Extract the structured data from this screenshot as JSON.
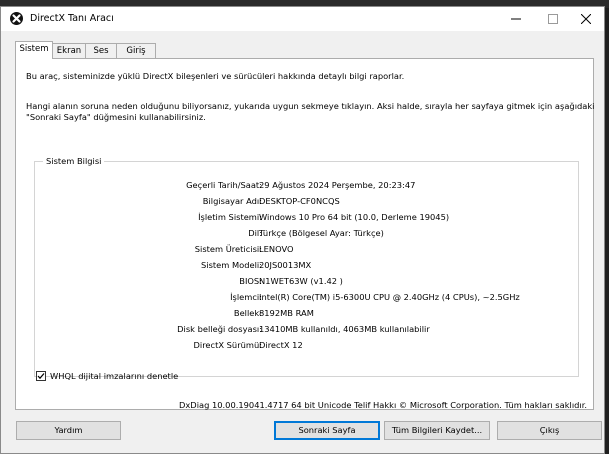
{
  "window": {
    "title": "DirectX Tanı Aracı"
  },
  "tabs": [
    {
      "label": "Sistem"
    },
    {
      "label": "Ekran"
    },
    {
      "label": "Ses"
    },
    {
      "label": "Giriş"
    }
  ],
  "intro": {
    "line1": "Bu araç, sisteminizde yüklü DirectX bileşenleri ve sürücüleri hakkında detaylı bilgi raporlar.",
    "line2": "Hangi alanın soruna neden olduğunu biliyorsanız, yukarıda uygun sekmeye tıklayın. Aksi halde, sırayla her sayfaya gitmek için aşağıdaki",
    "line3": "\"Sonraki Sayfa\" düğmesini kullanabilirsiniz."
  },
  "system_info": {
    "group_title": "Sistem Bilgisi",
    "rows": [
      {
        "label": "Geçerli Tarih/Saat:",
        "value": "29 Ağustos 2024 Perşembe, 20:23:47"
      },
      {
        "label": "Bilgisayar Adı:",
        "value": "DESKTOP-CF0NCQS"
      },
      {
        "label": "İşletim Sistemi:",
        "value": "Windows 10 Pro 64 bit (10.0, Derleme 19045)"
      },
      {
        "label": "Dil:",
        "value": "Türkçe (Bölgesel Ayar: Türkçe)"
      },
      {
        "label": "Sistem Üreticisi:",
        "value": "LENOVO"
      },
      {
        "label": "Sistem Modeli:",
        "value": "20JS0013MX"
      },
      {
        "label": "BIOS:",
        "value": "N1WET63W (v1.42 )"
      },
      {
        "label": "İşlemci:",
        "value": "Intel(R) Core(TM) i5-6300U CPU @ 2.40GHz (4 CPUs), ~2.5GHz"
      },
      {
        "label": "Bellek:",
        "value": "8192MB RAM"
      },
      {
        "label": "Disk belleği dosyası:",
        "value": "13410MB kullanıldı, 4063MB kullanılabilir"
      },
      {
        "label": "DirectX Sürümü:",
        "value": "DirectX 12"
      }
    ]
  },
  "whql": {
    "label": "WHQL dijital imzalarını denetle",
    "checked": true
  },
  "footer_text": "DxDiag 10.00.19041.4717 64 bit Unicode  Telif Hakkı © Microsoft Corporation. Tüm hakları saklıdır.",
  "buttons": {
    "help": "Yardım",
    "next": "Sonraki Sayfa",
    "save_all": "Tüm Bilgileri Kaydet...",
    "exit": "Çıkış"
  },
  "icons": {
    "app": "directx-icon",
    "minimize": "minimize-icon",
    "maximize": "maximize-icon",
    "close": "close-icon",
    "check": "checkmark-icon"
  },
  "colors": {
    "accent": "#0078d7"
  }
}
